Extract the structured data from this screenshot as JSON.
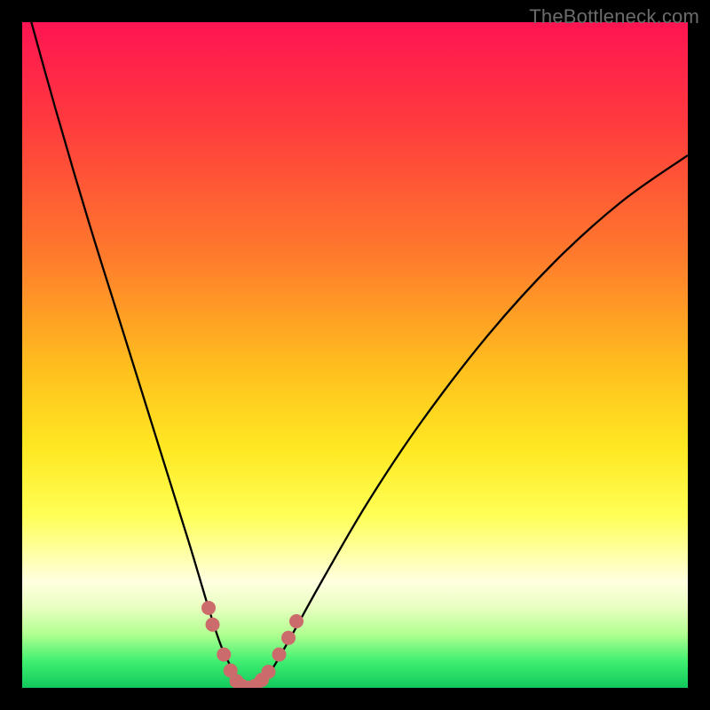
{
  "watermark": "TheBottleneck.com",
  "chart_data": {
    "type": "line",
    "title": "",
    "xlabel": "",
    "ylabel": "",
    "xlim": [
      0,
      100
    ],
    "ylim": [
      0,
      100
    ],
    "series": [
      {
        "name": "bottleneck-curve",
        "x": [
          0,
          5,
          10,
          15,
          20,
          25,
          28,
          30,
          32,
          33,
          34,
          35,
          37,
          40,
          45,
          52,
          60,
          70,
          80,
          90,
          100
        ],
        "y": [
          105,
          87,
          70,
          54,
          38,
          22,
          12,
          6,
          2,
          0.5,
          0,
          0.3,
          2,
          7,
          16,
          28,
          40,
          53,
          64,
          73,
          80
        ]
      }
    ],
    "markers": {
      "name": "highlight-dots",
      "color": "#cc6b6b",
      "points": [
        {
          "x": 28.0,
          "y": 12.0
        },
        {
          "x": 28.6,
          "y": 9.5
        },
        {
          "x": 30.3,
          "y": 5.0
        },
        {
          "x": 31.3,
          "y": 2.6
        },
        {
          "x": 32.2,
          "y": 1.0
        },
        {
          "x": 33.0,
          "y": 0.3
        },
        {
          "x": 34.0,
          "y": 0.0
        },
        {
          "x": 35.0,
          "y": 0.3
        },
        {
          "x": 36.0,
          "y": 1.2
        },
        {
          "x": 37.0,
          "y": 2.4
        },
        {
          "x": 38.6,
          "y": 5.0
        },
        {
          "x": 40.0,
          "y": 7.5
        },
        {
          "x": 41.2,
          "y": 10.0
        }
      ]
    }
  }
}
